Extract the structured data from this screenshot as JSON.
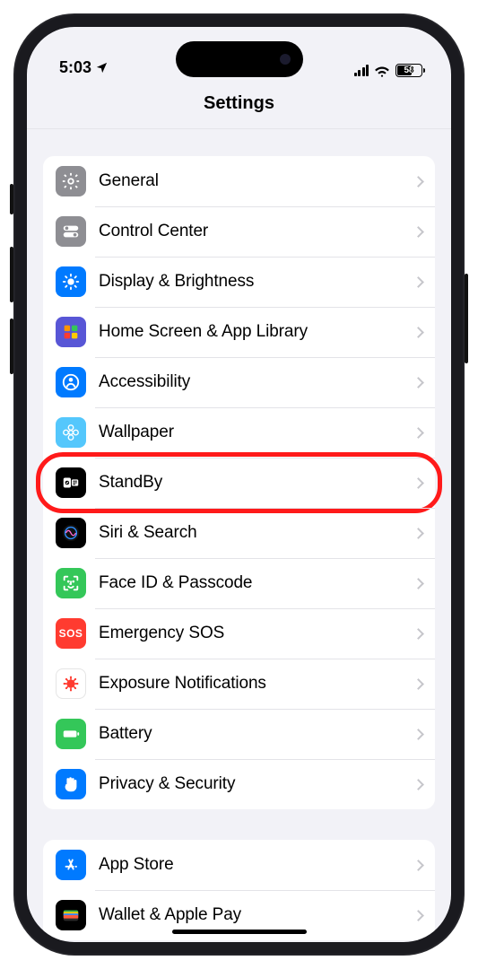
{
  "status": {
    "time": "5:03",
    "battery": "58"
  },
  "title": "Settings",
  "groups": [
    {
      "rows": [
        {
          "id": "general",
          "label": "General",
          "icon": "gear",
          "bg": "bg-gray"
        },
        {
          "id": "control-center",
          "label": "Control Center",
          "icon": "toggles",
          "bg": "bg-gray"
        },
        {
          "id": "display-brightness",
          "label": "Display & Brightness",
          "icon": "sun",
          "bg": "bg-blue"
        },
        {
          "id": "home-screen",
          "label": "Home Screen & App Library",
          "icon": "grid",
          "bg": "bg-purple"
        },
        {
          "id": "accessibility",
          "label": "Accessibility",
          "icon": "person",
          "bg": "bg-blue"
        },
        {
          "id": "wallpaper",
          "label": "Wallpaper",
          "icon": "flower",
          "bg": "bg-lblue"
        },
        {
          "id": "standby",
          "label": "StandBy",
          "icon": "standby",
          "bg": "bg-black",
          "highlight": true
        },
        {
          "id": "siri-search",
          "label": "Siri & Search",
          "icon": "siri",
          "bg": "bg-black"
        },
        {
          "id": "faceid-passcode",
          "label": "Face ID & Passcode",
          "icon": "faceid",
          "bg": "bg-green"
        },
        {
          "id": "emergency-sos",
          "label": "Emergency SOS",
          "icon": "sos",
          "bg": "bg-red"
        },
        {
          "id": "exposure-notifications",
          "label": "Exposure Notifications",
          "icon": "virus",
          "bg": "bg-white"
        },
        {
          "id": "battery",
          "label": "Battery",
          "icon": "battery",
          "bg": "bg-green"
        },
        {
          "id": "privacy-security",
          "label": "Privacy & Security",
          "icon": "hand",
          "bg": "bg-blue"
        }
      ]
    },
    {
      "rows": [
        {
          "id": "app-store",
          "label": "App Store",
          "icon": "appstore",
          "bg": "bg-blue"
        },
        {
          "id": "wallet-applepay",
          "label": "Wallet & Apple Pay",
          "icon": "wallet",
          "bg": "bg-black"
        }
      ]
    }
  ]
}
